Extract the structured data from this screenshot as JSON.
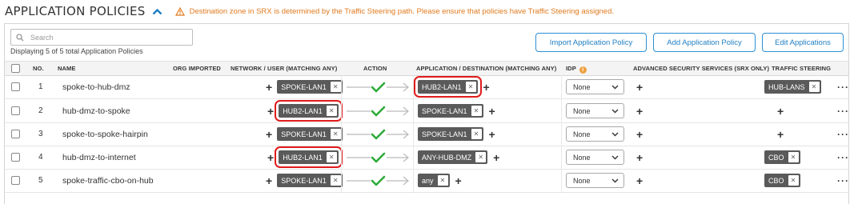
{
  "header": {
    "title": "APPLICATION POLICIES",
    "warning": "Destination zone in SRX is determined by the Traffic Steering path. Please ensure that policies have Traffic Steering assigned."
  },
  "toolbar": {
    "search_placeholder": "Search",
    "count_text": "Displaying 5 of 5 total Application Policies",
    "import_label": "Import Application Policy",
    "add_label": "Add Application Policy",
    "edit_label": "Edit Applications"
  },
  "columns": {
    "no": "NO.",
    "name": "NAME",
    "org_imported": "ORG IMPORTED",
    "network_user": "NETWORK / USER (MATCHING ANY)",
    "action": "ACTION",
    "application_destination": "APPLICATION / DESTINATION (MATCHING ANY)",
    "idp": "IDP",
    "advanced_security": "ADVANCED SECURITY SERVICES (SRX ONLY)",
    "traffic_steering": "TRAFFIC STEERING"
  },
  "rows": [
    {
      "no": "1",
      "name": "spoke-to-hub-dmz",
      "network": "SPOKE-LAN1",
      "destination": "HUB2-LAN1",
      "idp": "None",
      "steering": "HUB-LANS"
    },
    {
      "no": "2",
      "name": "hub-dmz-to-spoke",
      "network": "HUB2-LAN1",
      "destination": "SPOKE-LAN1",
      "idp": "None",
      "steering": ""
    },
    {
      "no": "3",
      "name": "spoke-to-spoke-hairpin",
      "network": "SPOKE-LAN1",
      "destination": "SPOKE-LAN1",
      "idp": "None",
      "steering": ""
    },
    {
      "no": "4",
      "name": "hub-dmz-to-internet",
      "network": "HUB2-LAN1",
      "destination": "ANY-HUB-DMZ",
      "idp": "None",
      "steering": "CBO"
    },
    {
      "no": "5",
      "name": "spoke-traffic-cbo-on-hub",
      "network": "SPOKE-LAN1",
      "destination": "any",
      "idp": "None",
      "steering": "CBO"
    }
  ],
  "colors": {
    "accent": "#1f7fc4",
    "warning": "#e07a1e",
    "highlight": "#e01b1b",
    "tag_bg": "#5a5a5a",
    "check": "#2eaa3a"
  }
}
